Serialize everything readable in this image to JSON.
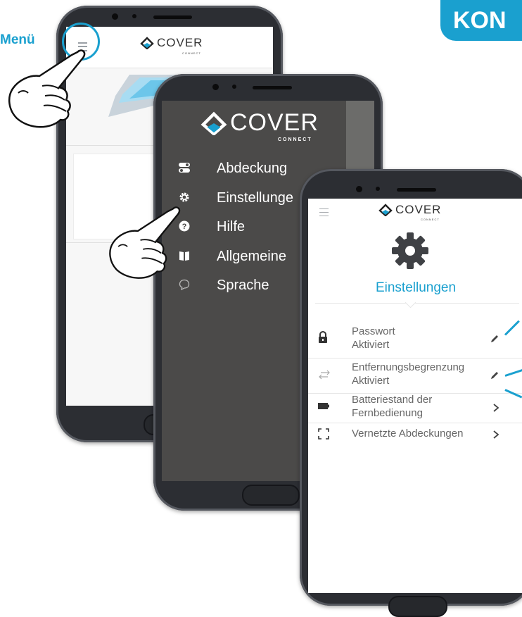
{
  "corner_badge": "KON",
  "menu_callout": "Menü",
  "brand": {
    "name": "COVER",
    "sub": "CONNECT",
    "accent": "#1aa0cf"
  },
  "drawer": {
    "items": [
      {
        "label": "Abdeckung",
        "icon": "toggle-icon"
      },
      {
        "label": "Einstellunge",
        "icon": "gear-icon"
      },
      {
        "label": "Hilfe",
        "icon": "help-icon"
      },
      {
        "label": "Allgemeine",
        "icon": "book-icon"
      },
      {
        "label": "Sprache",
        "icon": "chat-icon"
      }
    ]
  },
  "settings": {
    "title": "Einstellungen",
    "rows": [
      {
        "line1": "Passwort",
        "line2": "Aktiviert",
        "icon": "lock-icon",
        "action": "edit-icon"
      },
      {
        "line1": "Entfernungsbegrenzung",
        "line2": "Aktiviert",
        "icon": "arrows-icon",
        "action": "edit-icon"
      },
      {
        "line1": "Batteriestand der",
        "line2": "Fernbedienung",
        "icon": "battery-icon",
        "action": "chevron-right-icon"
      },
      {
        "line1": "Vernetzte Abdeckungen",
        "line2": "",
        "icon": "frame-icon",
        "action": "chevron-right-icon"
      }
    ]
  }
}
